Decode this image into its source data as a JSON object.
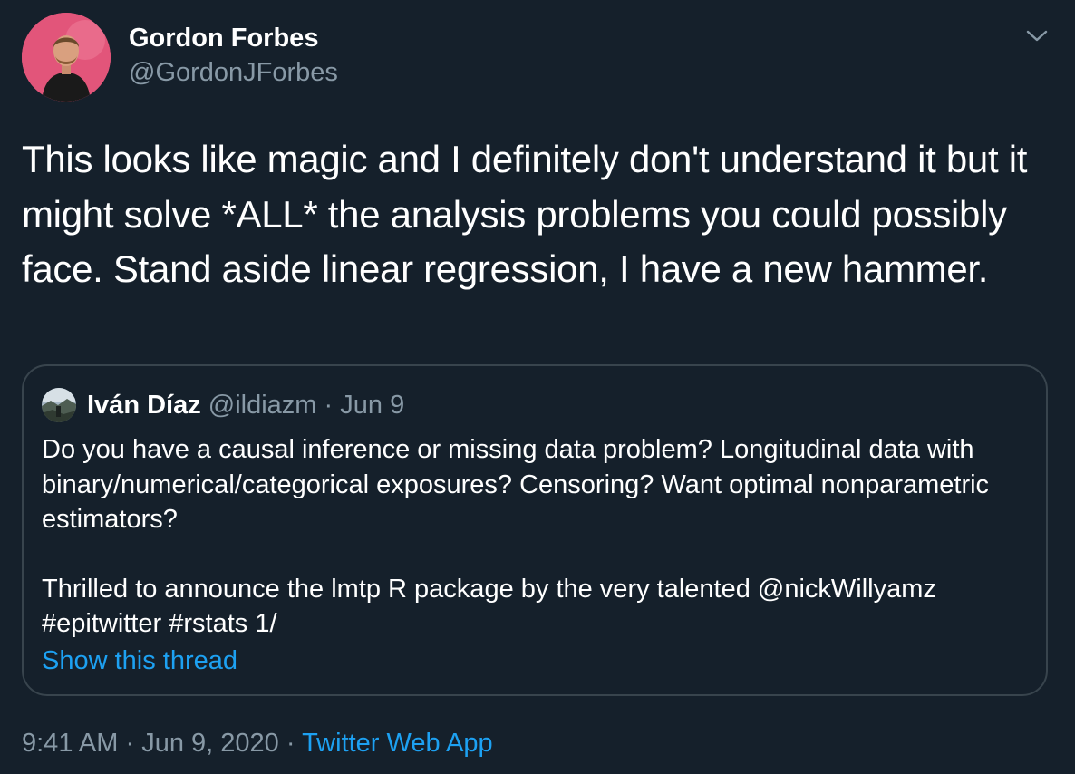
{
  "colors": {
    "background": "#15202b",
    "primary_text": "#ffffff",
    "secondary_text": "#8899a6",
    "link": "#1da1f2",
    "border": "#38444d",
    "avatar_bg": "#e2557a"
  },
  "tweet": {
    "author": {
      "name": "Gordon Forbes",
      "handle": "@GordonJForbes",
      "avatar_icon": "profile-photo"
    },
    "menu_icon": "chevron-down-icon",
    "text": "This looks like magic and I definitely don't understand it but it might solve *ALL* the analysis problems you could possibly face. Stand aside linear regression, I have a new hammer.",
    "quoted": {
      "name": "Iván Díaz",
      "handle": "@ildiazm",
      "separator": "·",
      "date": "Jun 9",
      "paragraph1": "Do you have a causal inference or missing data problem? Longitudinal data with binary/numerical/categorical exposures? Censoring? Want optimal nonparametric estimators?",
      "paragraph2": "Thrilled to announce the lmtp R package by the very talented @nickWillyamz #epitwitter #rstats 1/",
      "show_thread": "Show this thread"
    },
    "time": "9:41 AM",
    "date": "Jun 9, 2020",
    "separator": "·",
    "source": "Twitter Web App"
  }
}
